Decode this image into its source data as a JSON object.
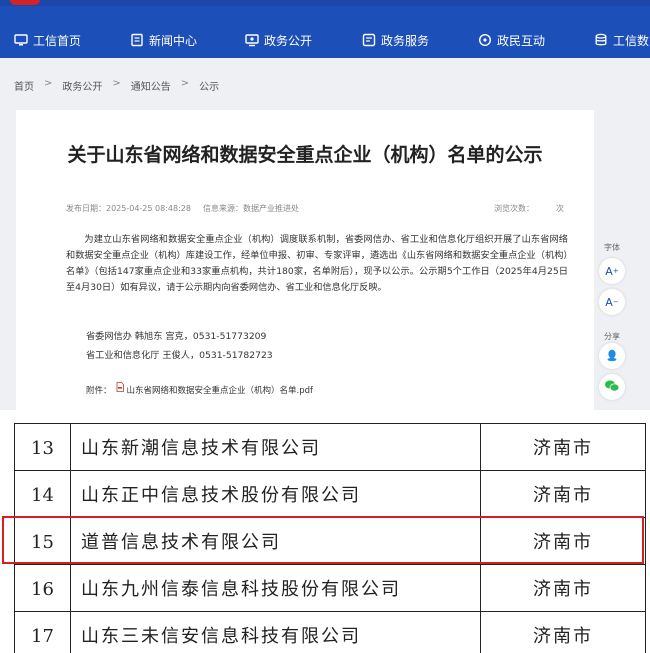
{
  "nav": {
    "items": [
      {
        "label": "工信首页",
        "icon": "monitor-icon"
      },
      {
        "label": "新闻中心",
        "icon": "news-icon"
      },
      {
        "label": "政务公开",
        "icon": "screen-icon"
      },
      {
        "label": "政务服务",
        "icon": "document-icon"
      },
      {
        "label": "政民互动",
        "icon": "chat-icon"
      },
      {
        "label": "工信数",
        "icon": "database-icon"
      }
    ]
  },
  "breadcrumb": [
    "首页",
    "政务公开",
    "通知公告",
    "公示"
  ],
  "article": {
    "title": "关于山东省网络和数据安全重点企业（机构）名单的公示",
    "publish_date": "发布日期：2025-04-25 08:48:28",
    "source": "信息来源：数据产业推进处",
    "views": "浏览次数：",
    "views_unit": "次",
    "paragraph": "为建立山东省网络和数据安全重点企业（机构）调度联系机制，省委网信办、省工业和信息化厅组织开展了山东省网络和数据安全重点企业（机构）库建设工作，经单位申报、初审、专家评审，遴选出《山东省网络和数据安全重点企业（机构）名单》（包括147家重点企业和33家重点机构，共计180家，名单附后），现予以公示。公示期5个工作日（2025年4月25日至4月30日）如有异议，请于公示期内向省委网信办、省工业和信息化厅反映。",
    "contact1": "省委网信办 韩旭东 宫克，0531-51773209",
    "contact2": "省工业和信息化厅 王俊人，0531-51782723",
    "attachment_label": "附件：",
    "attachment_file": "山东省网络和数据安全重点企业（机构）名单.pdf"
  },
  "side": {
    "font_label": "字体",
    "font_up": "A",
    "font_down": "A",
    "share_label": "分享"
  },
  "table": {
    "rows": [
      {
        "no": "13",
        "name": "山东新潮信息技术有限公司",
        "city": "济南市"
      },
      {
        "no": "14",
        "name": "山东正中信息技术股份有限公司",
        "city": "济南市"
      },
      {
        "no": "15",
        "name": "道普信息技术有限公司",
        "city": "济南市"
      },
      {
        "no": "16",
        "name": "山东九州信泰信息科技股份有限公司",
        "city": "济南市"
      },
      {
        "no": "17",
        "name": "山东三未信安信息科技有限公司",
        "city": "济南市"
      }
    ],
    "highlighted_no": "15"
  },
  "colors": {
    "nav": "#1d4fb8",
    "highlight": "#d62020",
    "page_bg": "#eef0f4"
  }
}
